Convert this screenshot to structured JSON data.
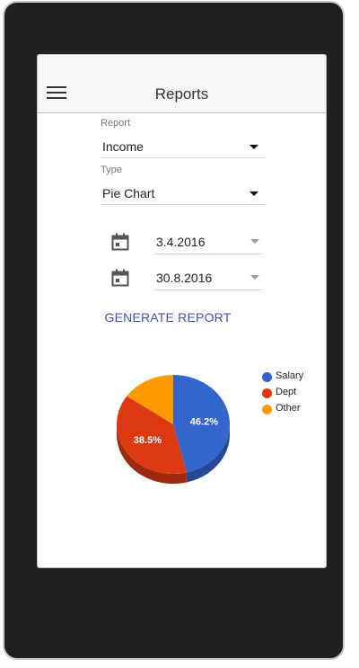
{
  "header": {
    "title": "Reports"
  },
  "form": {
    "report": {
      "label": "Report",
      "value": "Income"
    },
    "type": {
      "label": "Type",
      "value": "Pie Chart"
    },
    "date_from": "3.4.2016",
    "date_to": "30.8.2016",
    "generate_label": "GENERATE REPORT"
  },
  "icons": {
    "menu": "hamburger-menu-icon",
    "calendar": "calendar-icon",
    "dropdown": "dropdown-arrow-icon"
  },
  "colors": {
    "salary": "#3366cc",
    "dept": "#dc3912",
    "other": "#ff9900",
    "accent": "#3f51b5"
  },
  "chart_data": {
    "type": "pie",
    "title": "",
    "labels": [
      "Salary",
      "Dept",
      "Other"
    ],
    "values": [
      46.2,
      38.5,
      15.3
    ],
    "value_labels": [
      "46.2%",
      "38.5%",
      ""
    ],
    "colors": [
      "#3366cc",
      "#dc3912",
      "#ff9900"
    ],
    "legend_position": "right",
    "is_3d": true
  }
}
